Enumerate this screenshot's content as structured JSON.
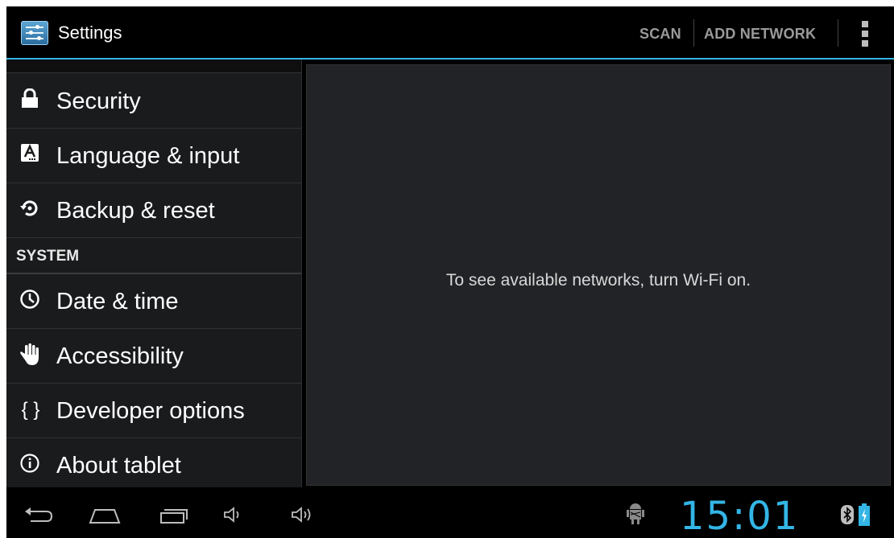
{
  "actionbar": {
    "title": "Settings",
    "actions": [
      "SCAN",
      "ADD NETWORK"
    ],
    "accent_color": "#33b5e5",
    "app_icon": "settings-app-icon",
    "overflow_icon": "overflow-menu-icon"
  },
  "sidebar": {
    "items": [
      {
        "label": "Security",
        "icon": "lock-icon"
      },
      {
        "label": "Language & input",
        "icon": "keyboard-a-icon"
      },
      {
        "label": "Backup & reset",
        "icon": "restore-icon"
      },
      {
        "label": "Date & time",
        "icon": "clock-icon"
      },
      {
        "label": "Accessibility",
        "icon": "hand-icon"
      },
      {
        "label": "Developer options",
        "icon": "braces-icon"
      },
      {
        "label": "About tablet",
        "icon": "info-icon"
      }
    ],
    "section_system": "SYSTEM"
  },
  "content": {
    "message": "To see available networks, turn Wi-Fi on."
  },
  "navbar": {
    "buttons": [
      "back-icon",
      "home-icon",
      "recent-apps-icon",
      "volume-down-icon",
      "volume-up-icon"
    ],
    "status_icons": [
      "android-debug-icon",
      "bluetooth-icon",
      "battery-charging-icon"
    ],
    "clock": "15:01",
    "clock_color": "#33b5e5"
  }
}
